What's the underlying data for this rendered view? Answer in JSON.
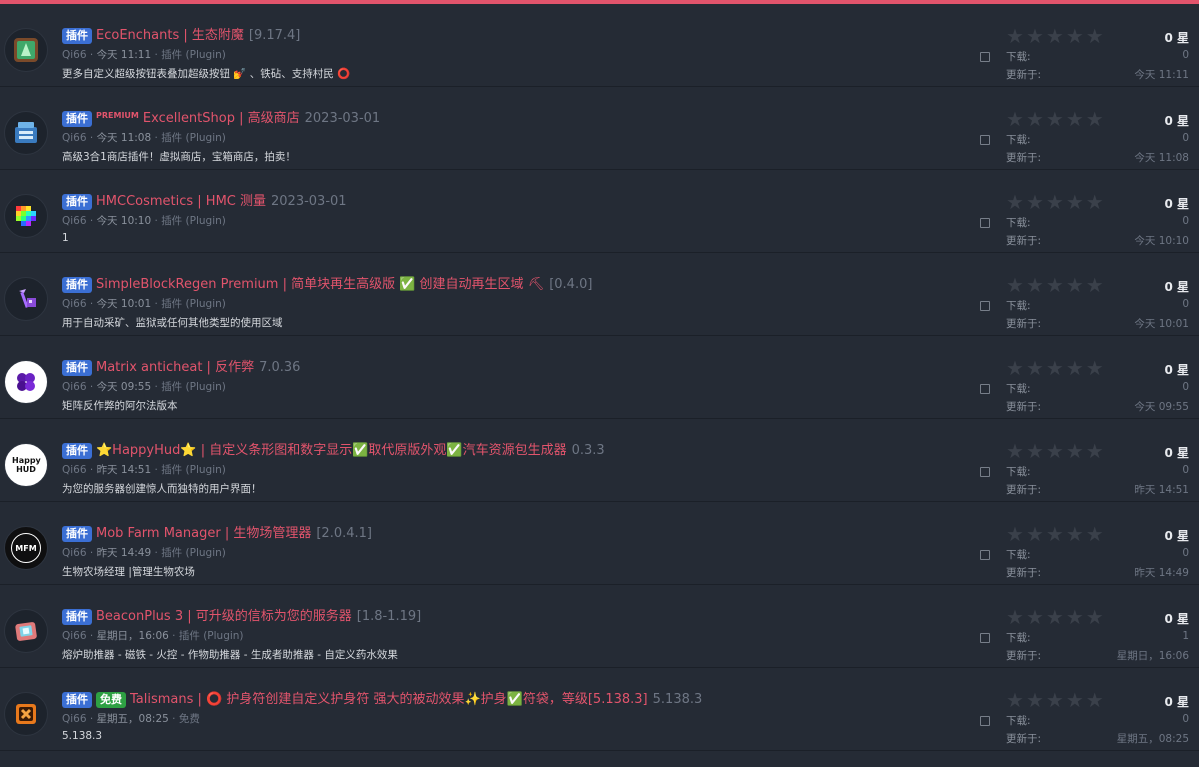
{
  "items": [
    {
      "badge": "插件",
      "title": "EcoEnchants | 生态附魔",
      "version": "[9.17.4]",
      "author": "Qi66",
      "time": "今天 11:11",
      "category": "插件",
      "type": "(Plugin)",
      "description": "更多自定义超级按钮表叠加超级按钮 💅 、铁砧、支持村民 ⭕",
      "rating": "0 星",
      "downloads_label": "下载:",
      "downloads": "0",
      "updated_label": "更新于:",
      "updated": "今天 11:11",
      "icon": "book-icon"
    },
    {
      "badge": "插件",
      "premium": "PREMIUM",
      "title": "ExcellentShop | 高级商店",
      "version": "2023-03-01",
      "author": "Qi66",
      "time": "今天 11:08",
      "category": "插件",
      "type": "(Plugin)",
      "description": "高级3合1商店插件！虚拟商店，宝箱商店，拍卖！",
      "rating": "0 星",
      "downloads_label": "下载:",
      "downloads": "0",
      "updated_label": "更新于:",
      "updated": "今天 11:08",
      "icon": "shop-icon"
    },
    {
      "badge": "插件",
      "title": "HMCCosmetics | HMC 测量",
      "version": "2023-03-01",
      "author": "Qi66",
      "time": "今天 10:10",
      "category": "插件",
      "type": "(Plugin)",
      "description": "1",
      "rating": "0 星",
      "downloads_label": "下载:",
      "downloads": "0",
      "updated_label": "更新于:",
      "updated": "今天 10:10",
      "icon": "rainbow-gem-icon"
    },
    {
      "badge": "插件",
      "title": "SimpleBlockRegen Premium | 简单块再生高级版 ✅ 创建自动再生区域 ⛏",
      "version": "[0.4.0]",
      "author": "Qi66",
      "time": "今天 10:01",
      "category": "插件",
      "type": "(Plugin)",
      "description": "用于自动采矿、监狱或任何其他类型的使用区域",
      "rating": "0 星",
      "downloads_label": "下载:",
      "downloads": "0",
      "updated_label": "更新于:",
      "updated": "今天 10:01",
      "icon": "pickaxe-icon"
    },
    {
      "badge": "插件",
      "title": "Matrix anticheat | 反作弊",
      "version": "7.0.36",
      "author": "Qi66",
      "time": "今天 09:55",
      "category": "插件",
      "type": "(Plugin)",
      "description": "矩阵反作弊的阿尔法版本",
      "rating": "0 星",
      "downloads_label": "下载:",
      "downloads": "0",
      "updated_label": "更新于:",
      "updated": "今天 09:55",
      "icon": "matrix-icon"
    },
    {
      "badge": "插件",
      "title": "⭐HappyHud⭐ | 自定义条形图和数字显示✅取代原版外观✅汽车资源包生成器",
      "version": "0.3.3",
      "author": "Qi66",
      "time": "昨天 14:51",
      "category": "插件",
      "type": "(Plugin)",
      "description": "为您的服务器创建惊人而独特的用户界面！",
      "rating": "0 星",
      "downloads_label": "下载:",
      "downloads": "0",
      "updated_label": "更新于:",
      "updated": "昨天 14:51",
      "icon": "happyhud-icon",
      "icon_text": "Happy HUD"
    },
    {
      "badge": "插件",
      "title": "Mob Farm Manager | 生物场管理器",
      "version": "[2.0.4.1]",
      "author": "Qi66",
      "time": "昨天 14:49",
      "category": "插件",
      "type": "(Plugin)",
      "description": "生物农场经理 |管理生物农场",
      "rating": "0 星",
      "downloads_label": "下载:",
      "downloads": "0",
      "updated_label": "更新于:",
      "updated": "昨天 14:49",
      "icon": "mfm-icon",
      "icon_text": "MFM"
    },
    {
      "badge": "插件",
      "title": "BeaconPlus 3 | 可升级的信标为您的服务器",
      "version": "[1.8-1.19]",
      "author": "Qi66",
      "time": "星期日，16:06",
      "category": "插件",
      "type": "(Plugin)",
      "description": "熔炉助推器 - 磁铁 - 火控 - 作物助推器 - 生成者助推器 - 自定义药水效果",
      "rating": "0 星",
      "downloads_label": "下载:",
      "downloads": "1",
      "updated_label": "更新于:",
      "updated": "星期日，16:06",
      "icon": "beacon-icon"
    },
    {
      "badge": "插件",
      "badge2": "免费",
      "title": "Talismans | ⭕ 护身符创建自定义护身符 强大的被动效果✨护身✅符袋，等级[5.138.3]",
      "version": "5.138.3",
      "author": "Qi66",
      "time": "星期五，08:25",
      "category": "免费",
      "type": "",
      "description": "5.138.3",
      "rating": "0 星",
      "downloads_label": "下载:",
      "downloads": "0",
      "updated_label": "更新于:",
      "updated": "星期五，08:25",
      "icon": "talisman-icon"
    }
  ]
}
